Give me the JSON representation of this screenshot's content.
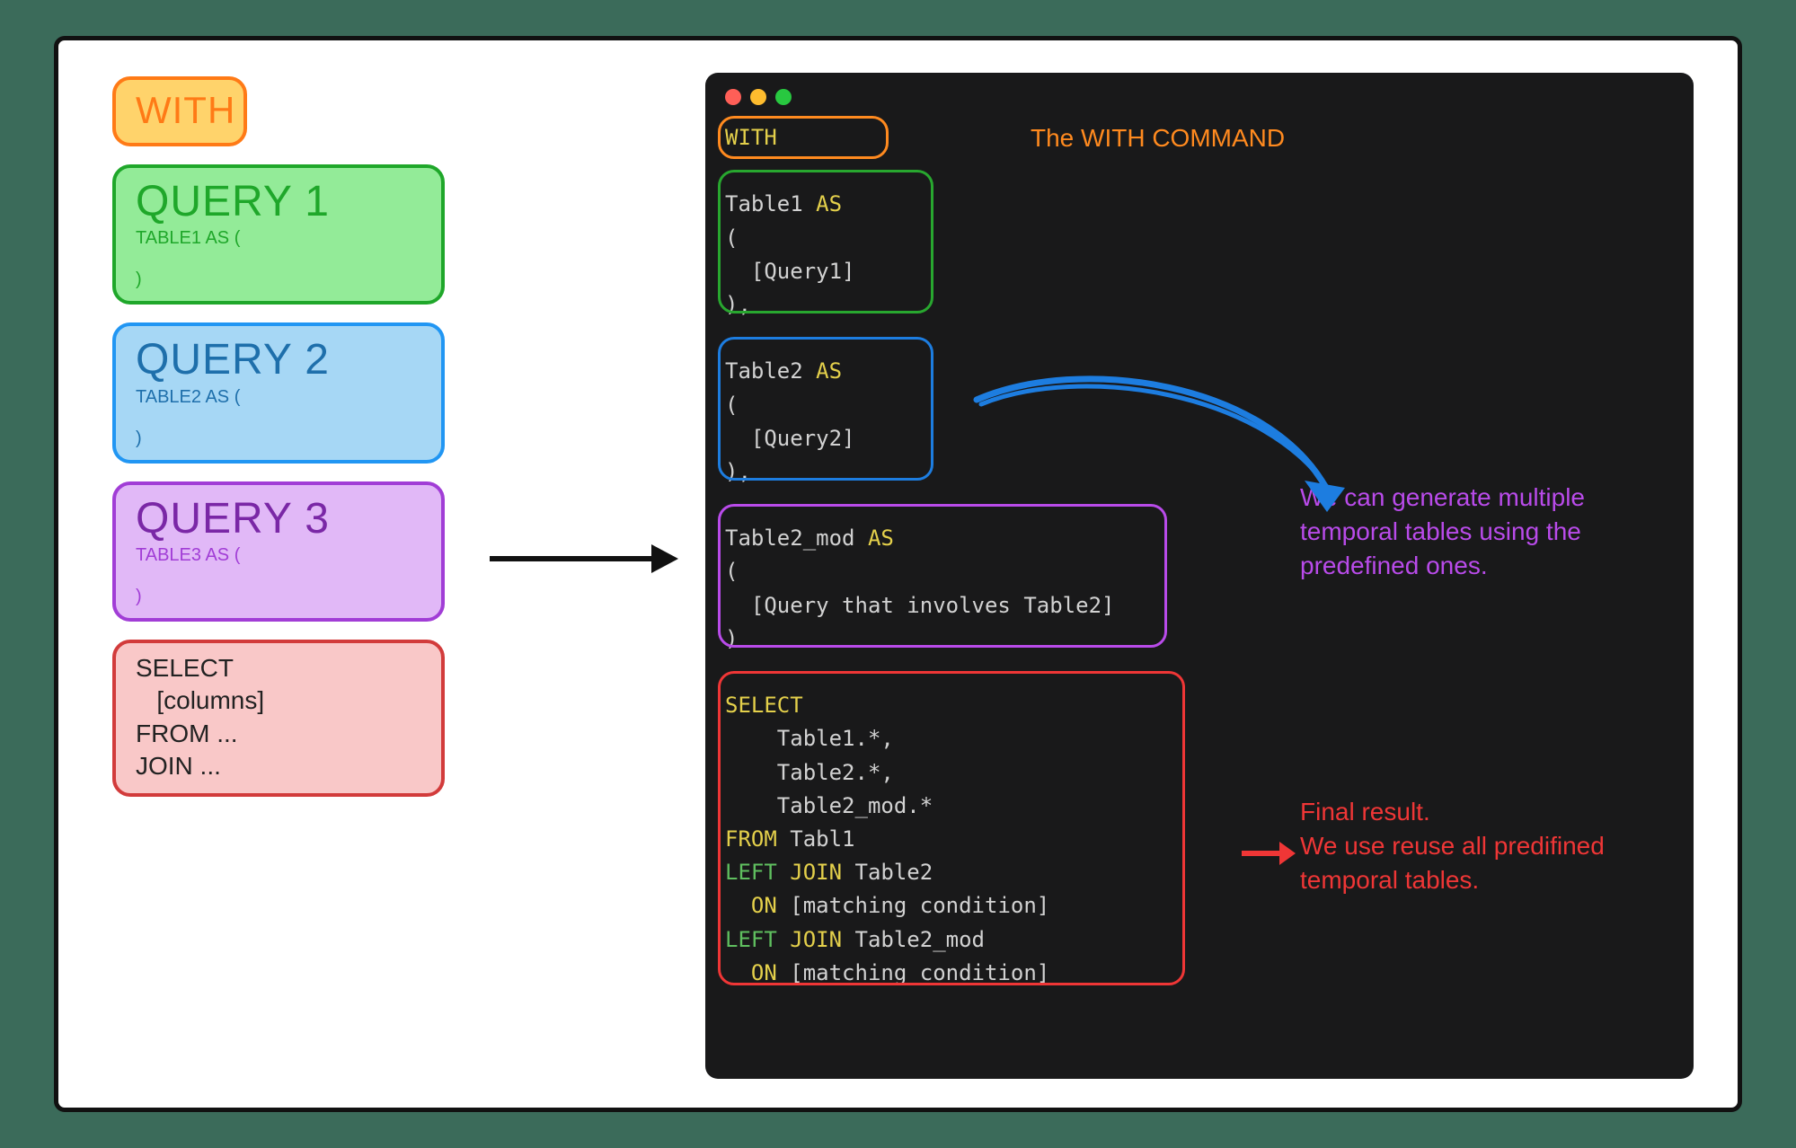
{
  "left": {
    "with": "WITH",
    "q1": {
      "header": "QUERY 1",
      "sub": "TABLE1 AS (\n\n)"
    },
    "q2": {
      "header": "QUERY 2",
      "sub": "TABLE2 AS (\n\n)"
    },
    "q3": {
      "header": "QUERY 3",
      "sub": "TABLE3 AS (\n\n)"
    },
    "final": "SELECT\n   [columns]\nFROM ...\nJOIN ..."
  },
  "terminal": {
    "with_kw": "WITH",
    "cte1": {
      "name": "Table1",
      "as": "AS",
      "open": "(",
      "body": "  [Query1]",
      "close": "),"
    },
    "cte2": {
      "name": "Table2",
      "as": "AS",
      "open": "(",
      "body": "  [Query2]",
      "close": "),"
    },
    "cte3": {
      "name": "Table2_mod",
      "as": "AS",
      "open": "(",
      "body": "  [Query that involves Table2]",
      "close": ")"
    },
    "final": {
      "select": "SELECT",
      "cols": "    Table1.*,\n    Table2.*,\n    Table2_mod.*",
      "from": "FROM",
      "from_tbl": " Tabl1",
      "left": "LEFT ",
      "join": "JOIN",
      "j1_tbl": " Table2",
      "on": "ON",
      "on_cond": " [matching condition]",
      "j2_tbl": " Table2_mod"
    }
  },
  "annotations": {
    "with": "The WITH COMMAND",
    "multi": "We can generate multiple temporal tables using the predefined ones.",
    "final": "Final result.\nWe use reuse all predifined temporal tables."
  }
}
